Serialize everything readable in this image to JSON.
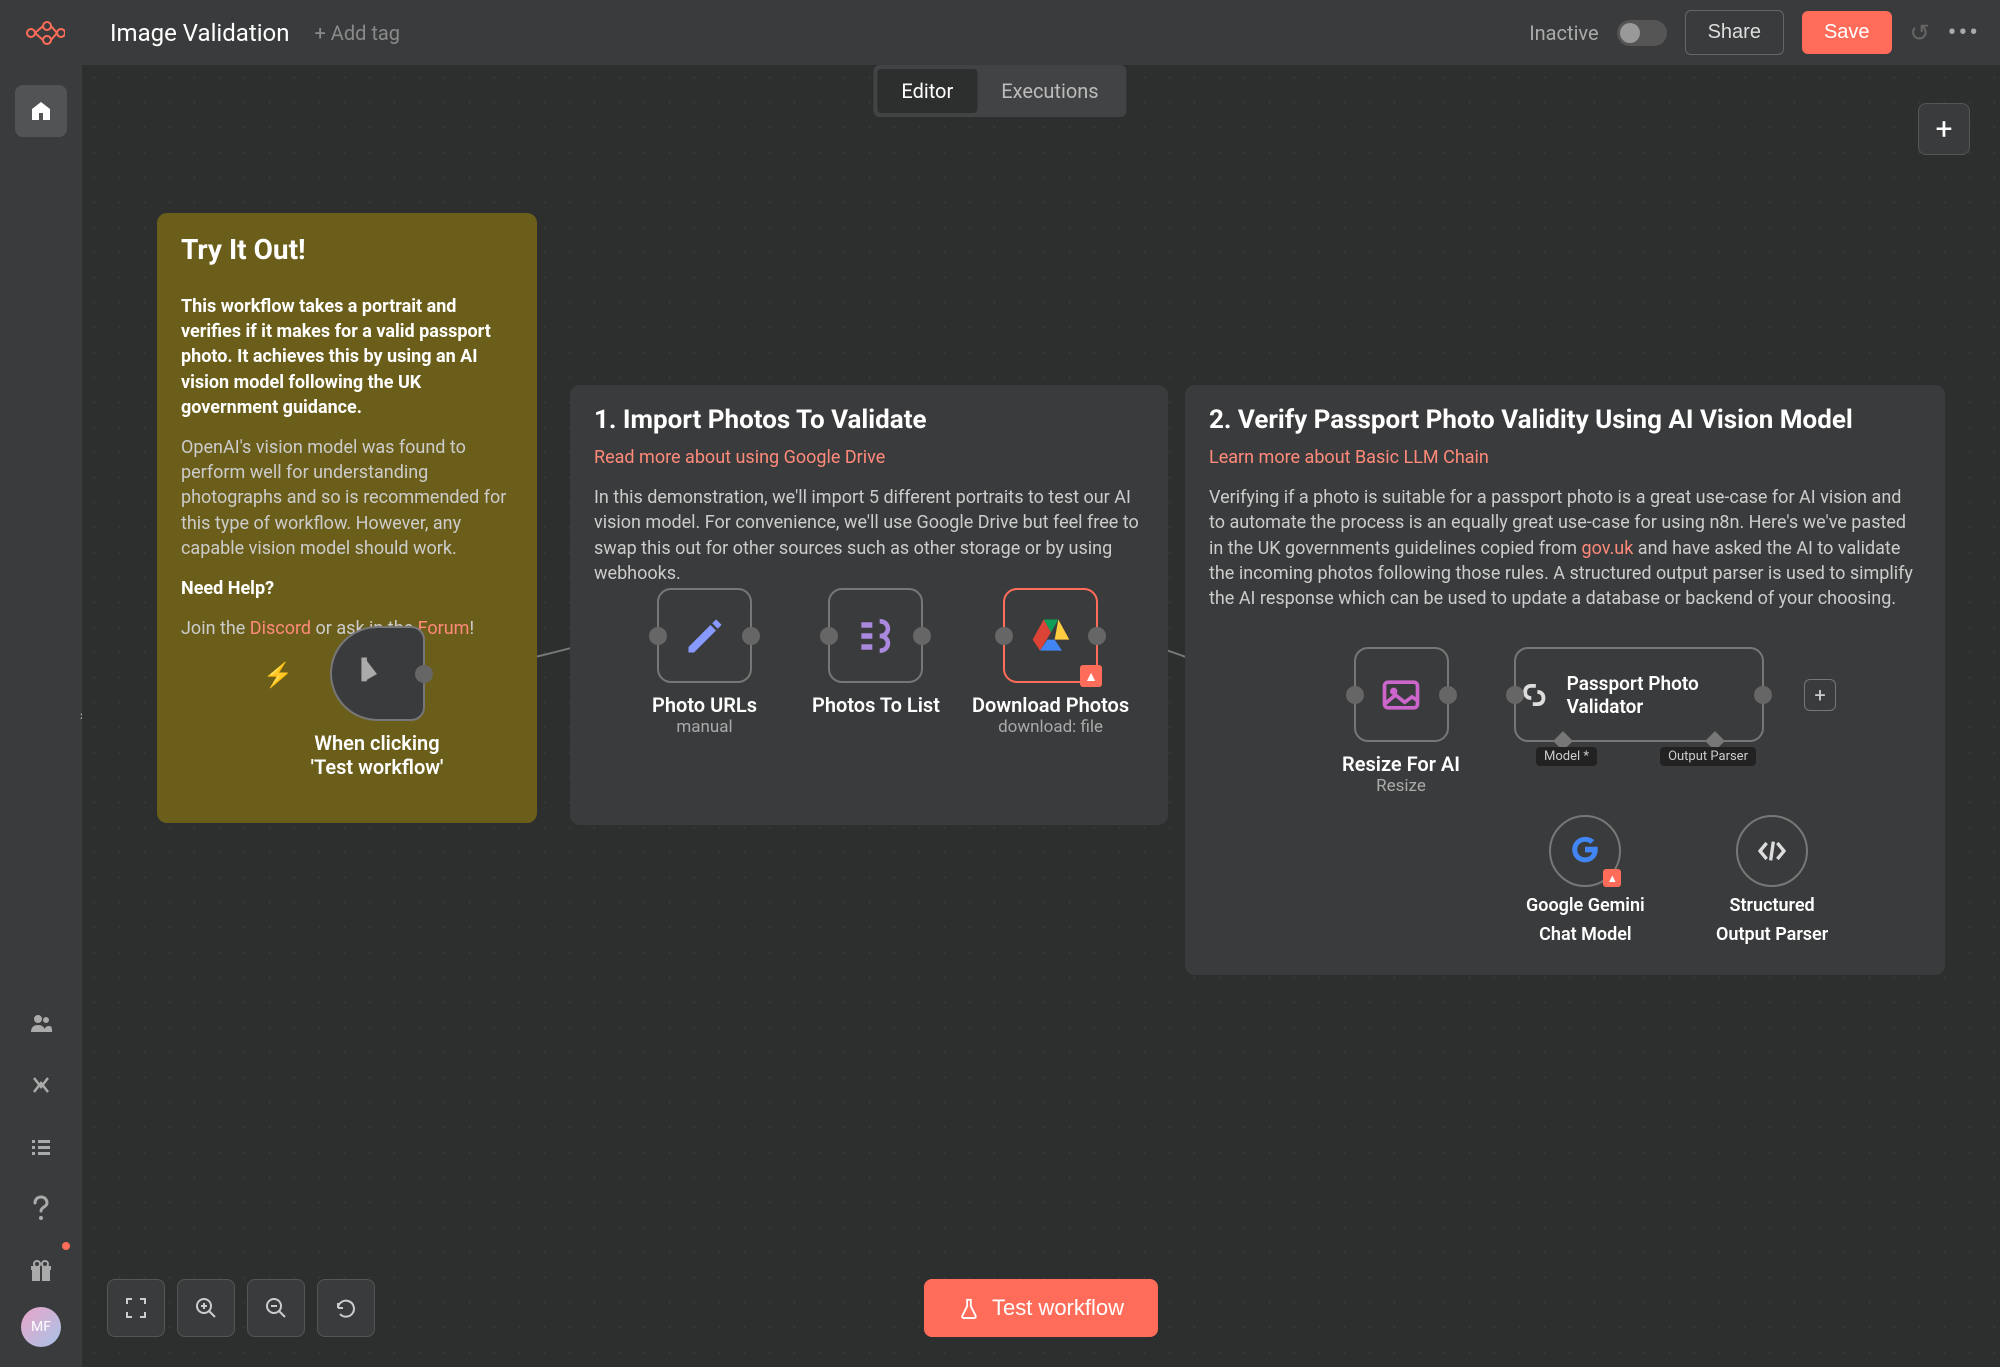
{
  "header": {
    "title": "Image Validation",
    "add_tag": "+ Add tag",
    "inactive": "Inactive",
    "share": "Share",
    "save": "Save"
  },
  "tabs": {
    "editor": "Editor",
    "executions": "Executions"
  },
  "sticky1": {
    "title": "Try It Out!",
    "p1_bold": "This workflow takes a portrait and verifies if it makes for a valid passport photo. It achieves this by using an AI vision model following the UK government guidance.",
    "p2": "OpenAI's vision model was found to perform well for understanding photographs and so is recommended for this type of workflow. However, any capable vision model should work.",
    "help_title": "Need Help?",
    "help_prefix": "Join the ",
    "discord": "Discord",
    "help_mid": " or ask in the ",
    "forum": "Forum",
    "help_suffix": "!"
  },
  "sticky2": {
    "title": "1. Import Photos To Validate",
    "link": "Read more about using Google Drive",
    "body": "In this demonstration, we'll import 5 different portraits to test our AI vision model. For convenience, we'll use Google Drive but feel free to swap this out for other sources such as other storage or by using webhooks."
  },
  "sticky3": {
    "title": "2. Verify Passport Photo Validity Using AI Vision Model",
    "link": "Learn more about Basic LLM Chain",
    "body_prefix": "Verifying if a photo is suitable for a passport photo is a great use-case for AI vision and to automate the process is an equally great use-case for using n8n. Here's we've pasted in the UK governments guidelines copied from ",
    "govuk": "gov.uk",
    "body_suffix": " and have asked the AI to validate the incoming photos following those rules. A structured output parser is used to simplify the AI response which can be used to update a database or backend of your choosing."
  },
  "nodes": {
    "trigger": {
      "label": "When clicking 'Test workflow'"
    },
    "photo_urls": {
      "label": "Photo URLs",
      "sub": "manual"
    },
    "photos_to_list": {
      "label": "Photos To List"
    },
    "download": {
      "label": "Download Photos",
      "sub": "download: file"
    },
    "resize": {
      "label": "Resize For AI",
      "sub": "Resize"
    },
    "validator": {
      "label": "Passport Photo Validator"
    },
    "gemini": {
      "label1": "Google Gemini",
      "label2": "Chat Model"
    },
    "parser": {
      "label1": "Structured",
      "label2": "Output Parser"
    },
    "model_tag": "Model *",
    "output_tag": "Output Parser"
  },
  "bottom": {
    "test": "Test workflow"
  },
  "avatar": "MF"
}
